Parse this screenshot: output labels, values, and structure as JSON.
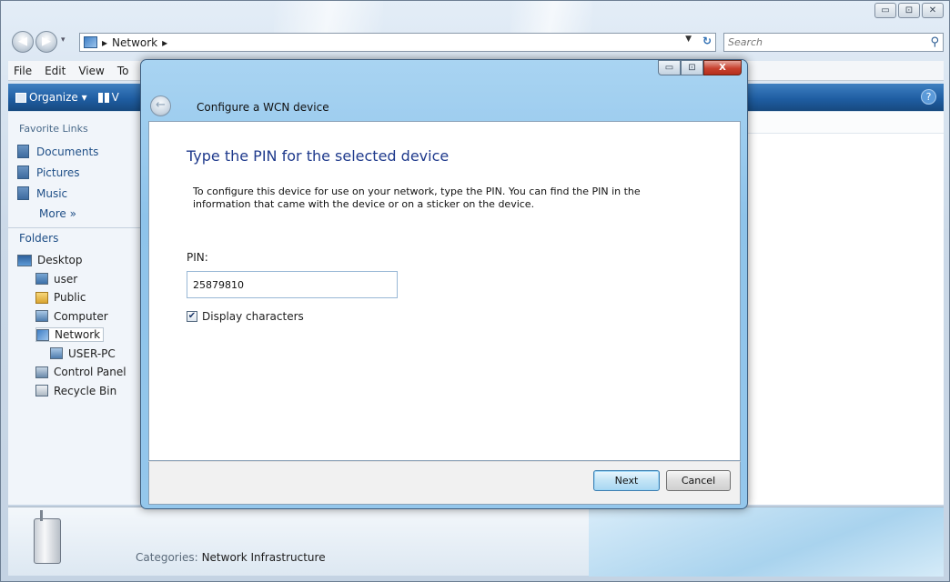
{
  "explorer": {
    "window_buttons": [
      "▭",
      "⊡",
      "✕"
    ],
    "address_path": "Network",
    "search_placeholder": "Search",
    "menu": [
      "File",
      "Edit",
      "View",
      "To"
    ],
    "toolbar": {
      "organize": "Organize ▾",
      "views": "V"
    },
    "nav": {
      "favorites_header": "Favorite Links",
      "favorites": [
        {
          "label": "Documents",
          "icon": "documents-icon"
        },
        {
          "label": "Pictures",
          "icon": "pictures-icon"
        },
        {
          "label": "Music",
          "icon": "music-icon"
        }
      ],
      "more": "More »",
      "folders_header": "Folders",
      "tree": [
        {
          "label": "Desktop",
          "icon": "desktop-icon",
          "indent": 0
        },
        {
          "label": "user",
          "icon": "user-folder-icon",
          "indent": 1
        },
        {
          "label": "Public",
          "icon": "folder-icon",
          "indent": 1
        },
        {
          "label": "Computer",
          "icon": "computer-icon",
          "indent": 1
        },
        {
          "label": "Network",
          "icon": "network-icon",
          "indent": 1,
          "selected": true
        },
        {
          "label": "USER-PC",
          "icon": "computer-icon",
          "indent": 2
        },
        {
          "label": "Control Panel",
          "icon": "control-panel-icon",
          "indent": 1
        },
        {
          "label": "Recycle Bin",
          "icon": "recycle-bin-icon",
          "indent": 1
        }
      ]
    },
    "details": {
      "key": "Categories:",
      "value": "Network Infrastructure"
    }
  },
  "dialog": {
    "title": "Configure a WCN device",
    "heading": "Type the PIN for the selected device",
    "description": "To configure this device for use on your network, type the PIN. You can find the PIN in the information that came with the device or on a sticker on the device.",
    "pin_label": "PIN:",
    "pin_value": "25879810",
    "display_characters_label": "Display characters",
    "display_characters_checked": true,
    "next_label": "Next",
    "cancel_label": "Cancel",
    "window_buttons": [
      "▭",
      "⊡",
      "X"
    ]
  }
}
